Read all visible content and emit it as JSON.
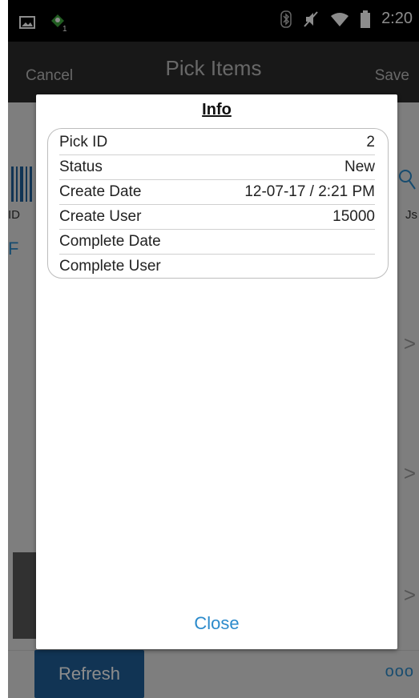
{
  "status_bar": {
    "time": "2:20",
    "left_icons": [
      "image-icon",
      "app-notification-icon"
    ],
    "right_icons": [
      "bluetooth-icon",
      "mute-icon",
      "wifi-icon",
      "battery-icon"
    ]
  },
  "app_bar": {
    "cancel_label": "Cancel",
    "title": "Pick Items",
    "save_label": "Save"
  },
  "background": {
    "left_fragment_1": "ID",
    "right_fragment_1": "Js",
    "left_fragment_2": "F",
    "chevron": ">",
    "refresh_label": "Refresh",
    "more_label": "ooo"
  },
  "dialog": {
    "title": "Info",
    "rows": [
      {
        "label": "Pick ID",
        "value": "2"
      },
      {
        "label": "Status",
        "value": "New"
      },
      {
        "label": "Create Date",
        "value": "12-07-17 / 2:21 PM"
      },
      {
        "label": "Create User",
        "value": "15000"
      },
      {
        "label": "Complete Date",
        "value": ""
      },
      {
        "label": "Complete User",
        "value": ""
      }
    ],
    "close_label": "Close"
  },
  "colors": {
    "accent": "#2b8acb",
    "refresh_button": "#1f5f9a",
    "app_bar": "#2c2c2c"
  }
}
